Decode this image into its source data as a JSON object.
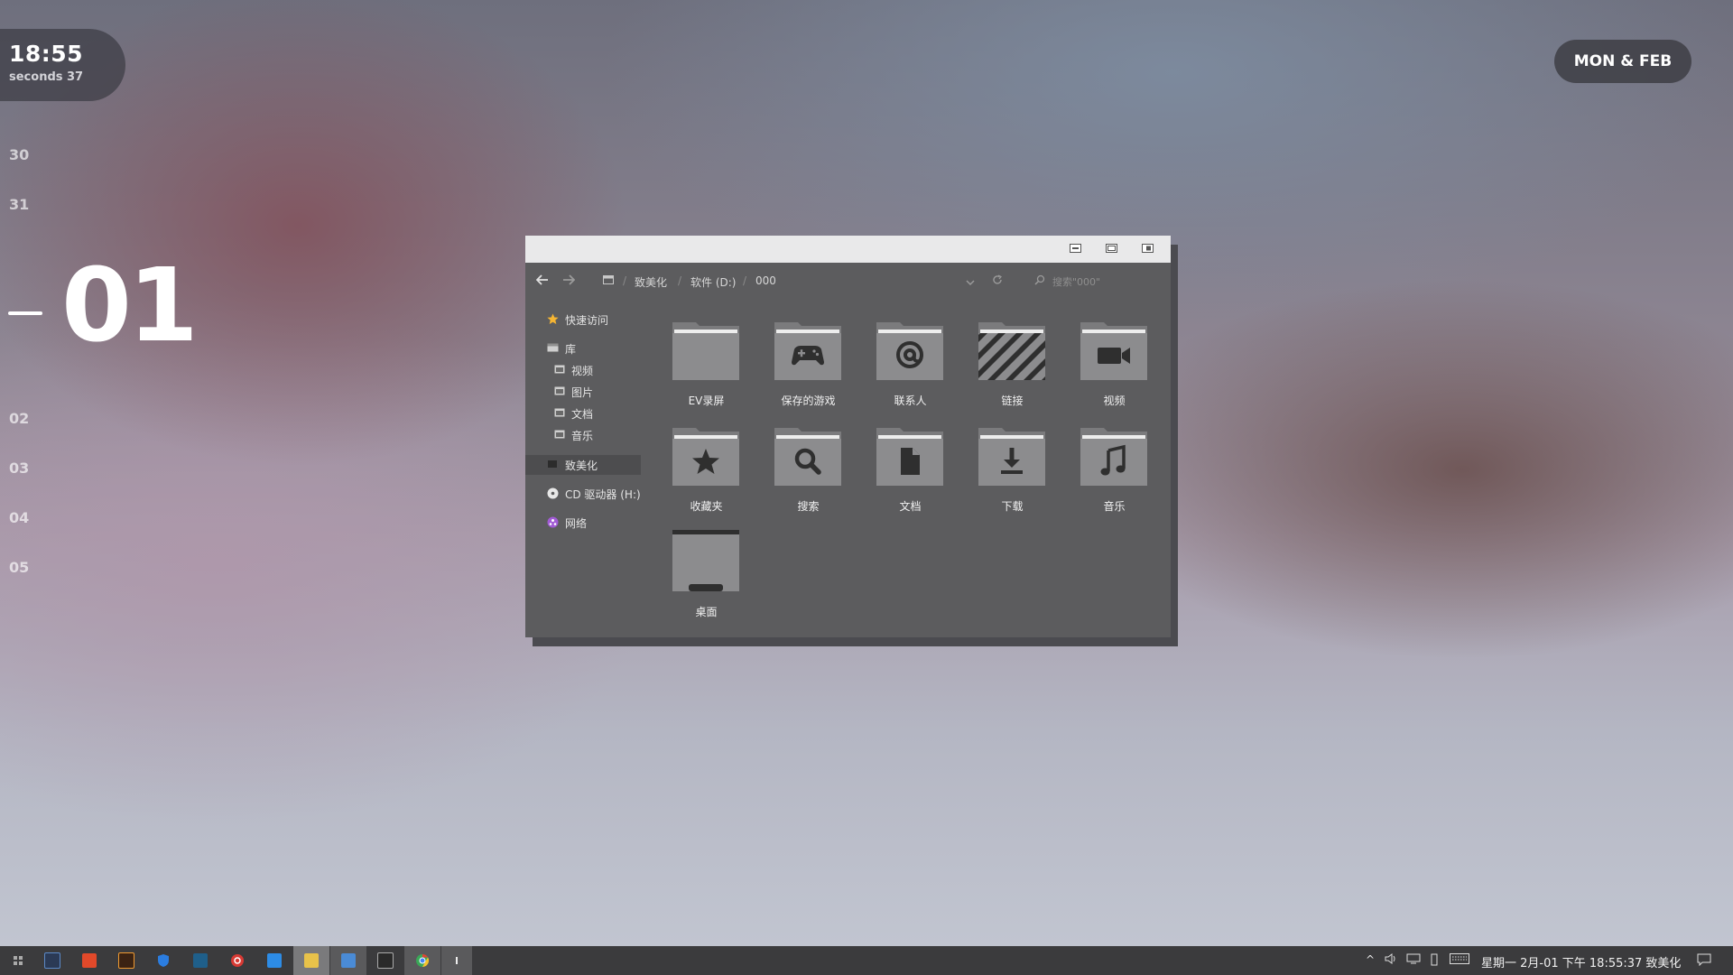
{
  "clock": {
    "time": "18:55",
    "seconds": "seconds 37"
  },
  "calendar": {
    "days_before": [
      "30",
      "31"
    ],
    "current_day": "01",
    "days_after": [
      "02",
      "03",
      "04",
      "05"
    ]
  },
  "date_badge": "MON & FEB",
  "explorer": {
    "breadcrumb": [
      "致美化",
      "软件 (D:)",
      "000"
    ],
    "search_placeholder": "搜索\"000\"",
    "sidebar": {
      "quick_access": "快速访问",
      "library": "库",
      "library_items": [
        "视频",
        "图片",
        "文档",
        "音乐"
      ],
      "selected": "致美化",
      "cd_drive": "CD 驱动器 (H:)",
      "network": "网络"
    },
    "folders": [
      {
        "label": "EV录屏",
        "icon": "plain-folder-icon"
      },
      {
        "label": "保存的游戏",
        "icon": "gamepad-folder-icon"
      },
      {
        "label": "联系人",
        "icon": "at-sign-folder-icon"
      },
      {
        "label": "链接",
        "icon": "striped-links-folder-icon"
      },
      {
        "label": "视频",
        "icon": "video-camera-folder-icon"
      },
      {
        "label": "收藏夹",
        "icon": "star-folder-icon"
      },
      {
        "label": "搜索",
        "icon": "magnifier-folder-icon"
      },
      {
        "label": "文档",
        "icon": "document-folder-icon"
      },
      {
        "label": "下载",
        "icon": "download-arrow-folder-icon"
      },
      {
        "label": "音乐",
        "icon": "music-note-folder-icon"
      },
      {
        "label": "桌面",
        "icon": "desktop-folder-icon"
      }
    ]
  },
  "taskbar": {
    "apps": [
      "start-icon",
      "photoshop-icon",
      "office-icon",
      "illustrator-icon",
      "shield-icon",
      "terminal-icon",
      "netease-music-icon",
      "word-icon",
      "file-explorer-icon",
      "save-disk-icon",
      "calculator-icon",
      "chrome-icon",
      "show-desktop-icon"
    ],
    "tray_text": "星期一 2月-01 下午 18:55:37 致美化"
  },
  "colors": {
    "window_bg": "#5c5c5e",
    "titlebar": "#e9e9ea",
    "folder": "#8a8a8c",
    "taskbar": "#3b3b3d"
  }
}
